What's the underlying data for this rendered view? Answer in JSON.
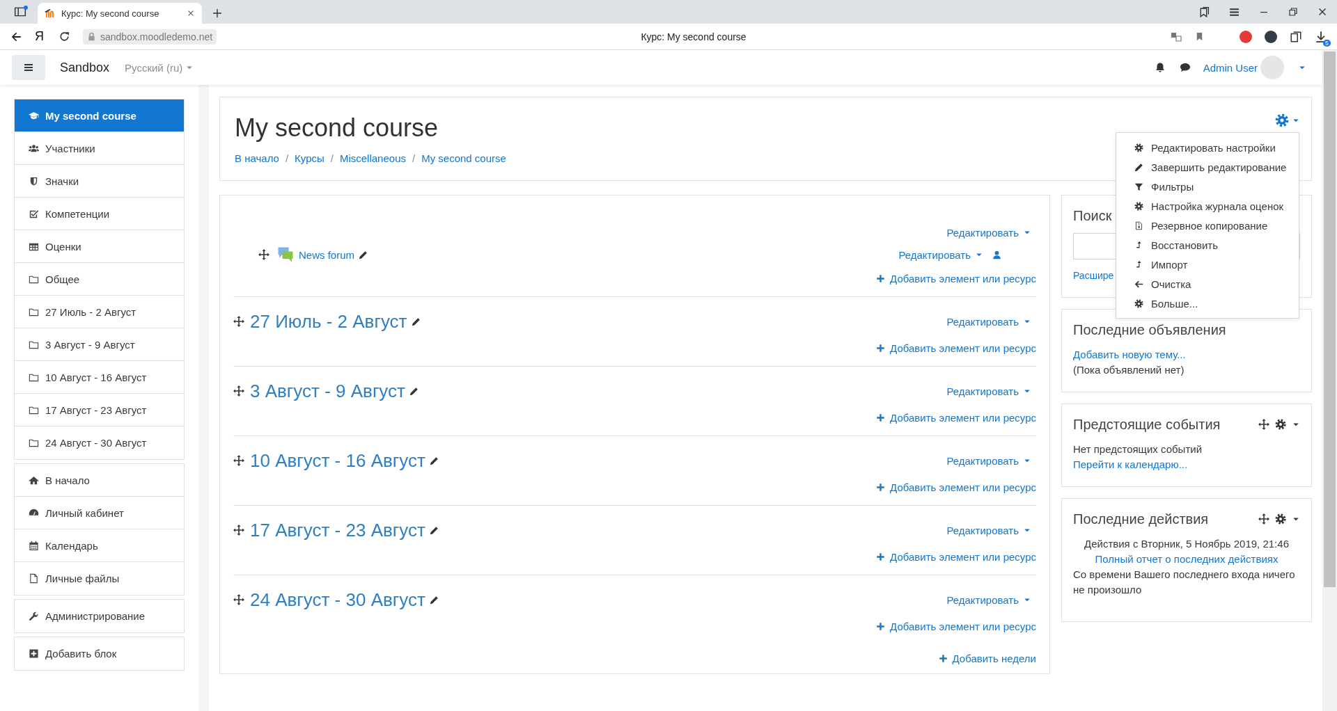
{
  "browser": {
    "tab": {
      "title": "Курс: My second course",
      "selected": true
    },
    "yandex": "Я",
    "url": "sandbox.moodledemo.net",
    "page_title": "Курс: My second course",
    "downloads_badge": "5"
  },
  "navbar": {
    "site": "Sandbox",
    "language": "Русский (ru)",
    "user": "Admin User"
  },
  "sidebar": {
    "groups": [
      {
        "items": [
          {
            "label": "My second course",
            "kind": "cap",
            "selected": true
          },
          {
            "label": "Участники",
            "kind": "users",
            "selected": false
          },
          {
            "label": "Значки",
            "kind": "shield",
            "selected": false
          },
          {
            "label": "Компетенции",
            "kind": "checkbox",
            "selected": false
          },
          {
            "label": "Оценки",
            "kind": "table",
            "selected": false
          },
          {
            "label": "Общее",
            "kind": "folder",
            "selected": false
          },
          {
            "label": "27 Июль - 2 Август",
            "kind": "folder",
            "selected": false
          },
          {
            "label": "3 Август - 9 Август",
            "kind": "folder",
            "selected": false
          },
          {
            "label": "10 Август - 16 Август",
            "kind": "folder",
            "selected": false
          },
          {
            "label": "17 Август - 23 Август",
            "kind": "folder",
            "selected": false
          },
          {
            "label": "24 Август - 30 Август",
            "kind": "folder",
            "selected": false
          }
        ]
      },
      {
        "items": [
          {
            "label": "В начало",
            "kind": "home",
            "selected": false
          },
          {
            "label": "Личный кабинет",
            "kind": "gauge",
            "selected": false
          },
          {
            "label": "Календарь",
            "kind": "calendar",
            "selected": false
          },
          {
            "label": "Личные файлы",
            "kind": "file",
            "selected": false
          }
        ]
      },
      {
        "items": [
          {
            "label": "Администрирование",
            "kind": "wrench",
            "selected": false
          }
        ]
      },
      {
        "items": [
          {
            "label": "Добавить блок",
            "kind": "plussq",
            "selected": false
          }
        ]
      }
    ]
  },
  "header": {
    "title": "My second course",
    "breadcrumb": [
      "В начало",
      "Курсы",
      "Miscellaneous",
      "My second course"
    ],
    "separator": "/"
  },
  "settings_menu": {
    "items": [
      {
        "label": "Редактировать настройки",
        "kind": "gear"
      },
      {
        "label": "Завершить редактирование",
        "kind": "pencil"
      },
      {
        "label": "Фильтры",
        "kind": "filter"
      },
      {
        "label": "Настройка журнала оценок",
        "kind": "gear"
      },
      {
        "label": "Резервное копирование",
        "kind": "backup"
      },
      {
        "label": "Восстановить",
        "kind": "upload"
      },
      {
        "label": "Импорт",
        "kind": "upload"
      },
      {
        "label": "Очистка",
        "kind": "back"
      },
      {
        "label": "Больше...",
        "kind": "gear"
      }
    ]
  },
  "general_section": {
    "edit": "Редактировать",
    "activity": {
      "name": "News forum",
      "edit": "Редактировать"
    },
    "add": "Добавить элемент или ресурс"
  },
  "weeks": [
    {
      "title": "27 Июль - 2 Август",
      "edit": "Редактировать",
      "add": "Добавить элемент или ресурс"
    },
    {
      "title": "3 Август - 9 Август",
      "edit": "Редактировать",
      "add": "Добавить элемент или ресурс"
    },
    {
      "title": "10 Август - 16 Август",
      "edit": "Редактировать",
      "add": "Добавить элемент или ресурс"
    },
    {
      "title": "17 Август - 23 Август",
      "edit": "Редактировать",
      "add": "Добавить элемент или ресурс"
    },
    {
      "title": "24 Август - 30 Август",
      "edit": "Редактировать",
      "add": "Добавить элемент или ресурс"
    }
  ],
  "add_weeks": "Добавить недели",
  "blocks": [
    {
      "kind": "search",
      "title": "Поиск",
      "link": "Расшире",
      "controls": false
    },
    {
      "kind": "news",
      "title": "Последние объявления",
      "link": "Добавить новую тему...",
      "text": "(Пока объявлений нет)",
      "controls": false
    },
    {
      "kind": "events",
      "title": "Предстоящие события",
      "text": "Нет предстоящих событий",
      "link": "Перейти к календарю...",
      "controls": true
    },
    {
      "kind": "recent",
      "title": "Последние действия",
      "text": "Действия с Вторник, 5 Ноябрь 2019, 21:46",
      "link": "Полный отчет о последних действиях",
      "note": "Со времени Вашего последнего входа ничего не произошло",
      "controls": true
    }
  ]
}
